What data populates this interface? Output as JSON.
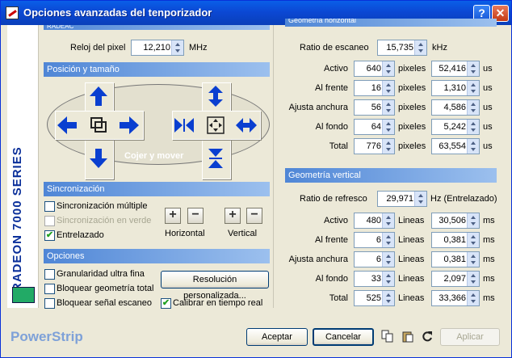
{
  "window": {
    "title": "Opciones avanzadas del tenporizador",
    "help_symbol": "?",
    "close_symbol": "✕"
  },
  "sidebar": {
    "text": "RADEON 7000 SERIES",
    "icon": "chip-icon"
  },
  "top_partial": {
    "header": "RADEAC",
    "pixel_clock_label": "Reloj del pixel",
    "pixel_clock_value": "12,210",
    "pixel_clock_unit": "MHz"
  },
  "position_size": {
    "header": "Posición y tamaño",
    "grab_label": "Cojer y mover",
    "icons": [
      "arrow-up-icon",
      "arrow-down-icon",
      "arrow-left-icon",
      "arrow-right-icon",
      "window-center-icon",
      "stretch-vertical-icon",
      "shrink-vertical-icon",
      "shrink-horizontal-icon",
      "stretch-horizontal-icon",
      "move-icon"
    ]
  },
  "sync": {
    "header": "Sincronización",
    "options": [
      {
        "label": "Sincronización múltiple",
        "checked": false,
        "disabled": false
      },
      {
        "label": "Sincronización en verde",
        "checked": false,
        "disabled": true
      },
      {
        "label": "Entrelazado",
        "checked": true,
        "disabled": false
      }
    ],
    "horizontal_label": "Horizontal",
    "vertical_label": "Vertical",
    "plus": "+",
    "minus": "−"
  },
  "options": {
    "header": "Opciones",
    "items": [
      {
        "label": "Granularidad ultra fina",
        "checked": false
      },
      {
        "label": "Bloquear geometría total",
        "checked": false
      },
      {
        "label": "Bloquear señal escaneo",
        "checked": false
      },
      {
        "label": "Calibrar en tiempo real",
        "checked": true
      }
    ],
    "custom_res_button": "Resolución personalizada..."
  },
  "horizontal_geometry": {
    "header": "Geometría horizontal",
    "scan_rate_label": "Ratio de escaneo",
    "scan_rate_value": "15,735",
    "scan_rate_unit": "kHz",
    "unit_left": "pixeles",
    "unit_right": "us",
    "rows": [
      {
        "label": "Activo",
        "left": "640",
        "right": "52,416"
      },
      {
        "label": "Al frente",
        "left": "16",
        "right": "1,310"
      },
      {
        "label": "Ajusta anchura",
        "left": "56",
        "right": "4,586"
      },
      {
        "label": "Al fondo",
        "left": "64",
        "right": "5,242"
      },
      {
        "label": "Total",
        "left": "776",
        "right": "63,554"
      }
    ]
  },
  "vertical_geometry": {
    "header": "Geometría vertical",
    "refresh_label": "Ratio de refresco",
    "refresh_value": "29,971",
    "refresh_unit": "Hz (Entrelazado)",
    "unit_left": "Lineas",
    "unit_right": "ms",
    "rows": [
      {
        "label": "Activo",
        "left": "480",
        "right": "30,506"
      },
      {
        "label": "Al frente",
        "left": "6",
        "right": "0,381"
      },
      {
        "label": "Ajusta anchura",
        "left": "6",
        "right": "0,381"
      },
      {
        "label": "Al fondo",
        "left": "33",
        "right": "2,097"
      },
      {
        "label": "Total",
        "left": "525",
        "right": "33,366"
      }
    ]
  },
  "footer": {
    "brand": "PowerStrip",
    "accept": "Aceptar",
    "cancel": "Cancelar",
    "apply": "Aplicar",
    "icons": [
      "copy-icon",
      "paste-icon",
      "refresh-icon"
    ]
  },
  "colors": {
    "accent": "#0a5fe8",
    "group_header": "#4f86d6",
    "background": "#ece9d8"
  }
}
